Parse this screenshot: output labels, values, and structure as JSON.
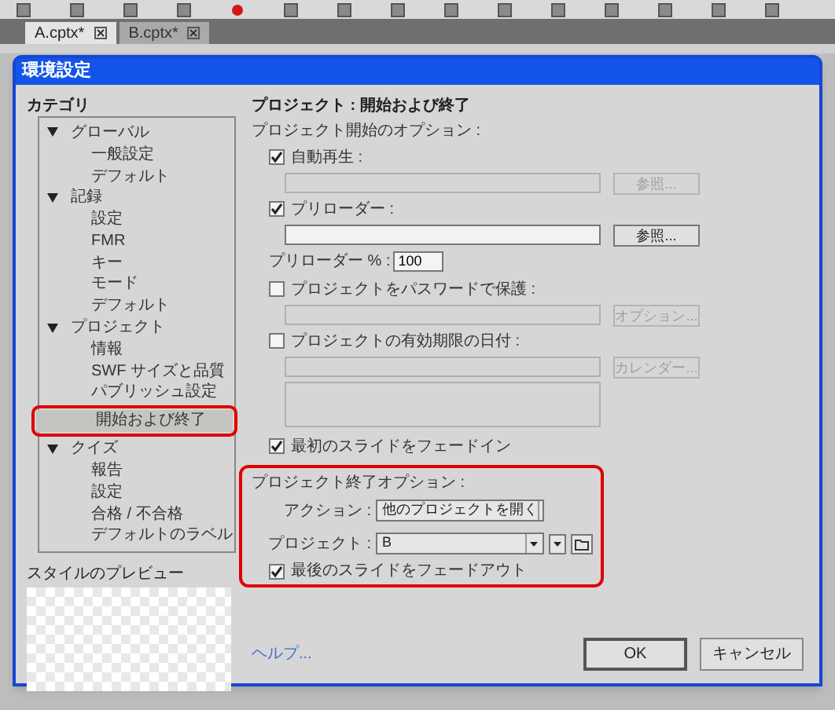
{
  "tabs": [
    {
      "label": "A.cptx*",
      "selected": true
    },
    {
      "label": "B.cptx*",
      "selected": false
    }
  ],
  "dialog": {
    "title": "環境設定",
    "category_label": "カテゴリ",
    "tree": [
      {
        "label": "グローバル",
        "expanded": true,
        "children": [
          {
            "label": "一般設定",
            "selected": false
          },
          {
            "label": "デフォルト",
            "selected": false
          }
        ]
      },
      {
        "label": "記録",
        "expanded": true,
        "children": [
          {
            "label": "設定",
            "selected": false
          },
          {
            "label": "FMR",
            "selected": false
          },
          {
            "label": "キー",
            "selected": false
          },
          {
            "label": "モード",
            "selected": false
          },
          {
            "label": "デフォルト",
            "selected": false
          }
        ]
      },
      {
        "label": "プロジェクト",
        "expanded": true,
        "children": [
          {
            "label": "情報",
            "selected": false
          },
          {
            "label": "SWF サイズと品質",
            "selected": false
          },
          {
            "label": "パブリッシュ設定",
            "selected": false
          },
          {
            "label": "開始および終了",
            "selected": true
          }
        ]
      },
      {
        "label": "クイズ",
        "expanded": true,
        "children": [
          {
            "label": "報告",
            "selected": false
          },
          {
            "label": "設定",
            "selected": false
          },
          {
            "label": "合格 / 不合格",
            "selected": false
          },
          {
            "label": "デフォルトのラベル",
            "selected": false
          }
        ]
      }
    ],
    "preview_label": "スタイルのプレビュー",
    "panel_title": "プロジェクト : 開始および終了",
    "start_heading": "プロジェクト開始のオプション :",
    "start_items": [
      {
        "kind": "checkbox",
        "label": "自動再生 :",
        "checked": true
      },
      {
        "kind": "field",
        "disabled": true,
        "button": "参照..."
      },
      {
        "kind": "checkbox",
        "label": "プリローダー :",
        "checked": true
      },
      {
        "kind": "field",
        "disabled": false,
        "button": "参照..."
      },
      {
        "kind": "number",
        "label": "プリローダー % :",
        "value": "100"
      },
      {
        "kind": "checkbox",
        "label": "プロジェクトをパスワードで保護 :",
        "checked": false
      },
      {
        "kind": "field",
        "disabled": true,
        "button": "オプション..."
      },
      {
        "kind": "checkbox",
        "label": "プロジェクトの有効期限の日付 :",
        "checked": false
      },
      {
        "kind": "field",
        "disabled": true,
        "button": "カレンダー..."
      },
      {
        "kind": "textarea",
        "disabled": true
      },
      {
        "kind": "checkbox",
        "label": "最初のスライドをフェードイン",
        "checked": true
      }
    ],
    "end_heading": "プロジェクト終了オプション :",
    "action": {
      "label": "アクション :",
      "value": "他のプロジェクトを開く"
    },
    "project": {
      "label": "プロジェクト :",
      "value": "B"
    },
    "fade_out": {
      "label": "最後のスライドをフェードアウト",
      "checked": true
    },
    "help_link": "ヘルプ...",
    "buttons": [
      "OK",
      "キャンセル"
    ]
  }
}
